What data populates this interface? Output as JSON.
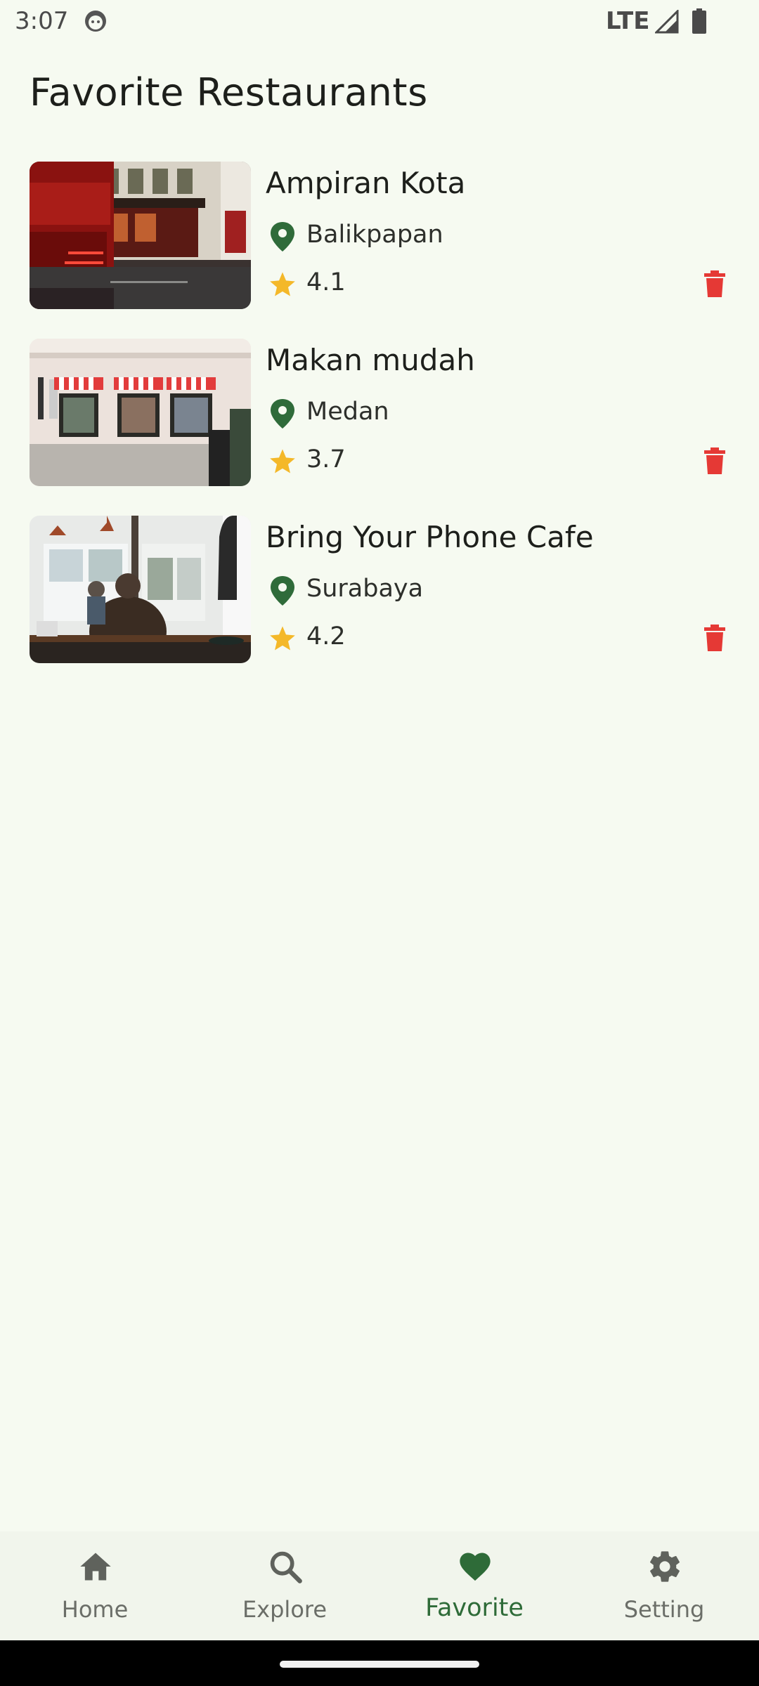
{
  "status_bar": {
    "time": "3:07",
    "network": "LTE"
  },
  "header": {
    "title": "Favorite Restaurants"
  },
  "restaurants": [
    {
      "name": "Ampiran Kota",
      "city": "Balikpapan",
      "rating": "4.1",
      "photo": "red-bus-passing-pub-storefront"
    },
    {
      "name": "Makan mudah",
      "city": "Medan",
      "rating": "3.7",
      "photo": "storefront-with-striped-awnings"
    },
    {
      "name": "Bring Your Phone Cafe",
      "city": "Surabaya",
      "rating": "4.2",
      "photo": "cafe-interior-man-at-window"
    }
  ],
  "bottom_nav": {
    "items": [
      {
        "label": "Home",
        "icon": "home-icon"
      },
      {
        "label": "Explore",
        "icon": "search-icon"
      },
      {
        "label": "Favorite",
        "icon": "heart-icon",
        "active": true
      },
      {
        "label": "Setting",
        "icon": "gear-icon"
      }
    ]
  },
  "colors": {
    "background": "#f6faf1",
    "accent_green": "#2e6b38",
    "location_pin": "#2f6b3a",
    "star": "#f4b829",
    "delete_red": "#e53935",
    "nav_inactive": "#6b6e68"
  }
}
